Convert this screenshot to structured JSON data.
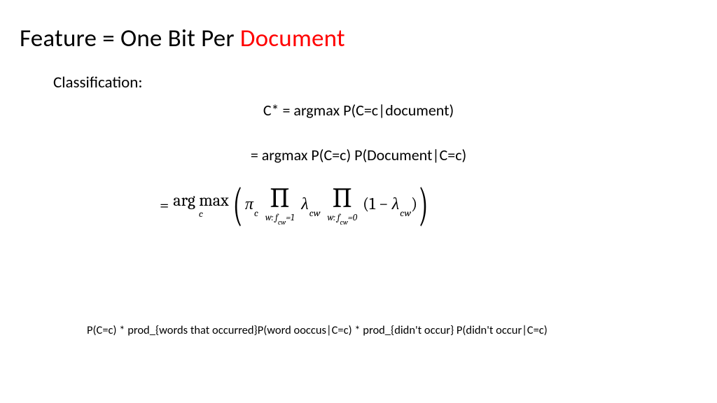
{
  "title_prefix": "Feature = One Bit Per ",
  "title_red": "Document",
  "subhead": "Classification:",
  "eq1": "C* = argmax P(C=c|document)",
  "eq2": "= argmax P(C=c) P(Document|C=c)",
  "math": {
    "eq": "=",
    "argmax_top": "arg max",
    "argmax_sub": "c",
    "lparen": "(",
    "rparen": ")",
    "pi": "π",
    "pi_sub": "c",
    "prod_sym": "∏",
    "prod1_sub_pre": "w: f",
    "prod1_sub_subsub": "cw",
    "prod1_sub_post": "=1",
    "lambda": "λ",
    "lambda_sub": "cw",
    "prod2_sub_pre": "w: f",
    "prod2_sub_subsub": "cw",
    "prod2_sub_post": "=0",
    "one_minus_open": "(1 − ",
    "one_minus_close": ")"
  },
  "footnote": "P(C=c) * prod_{words that occurred}P(word ooccus|C=c) * prod_{didn't occur} P(didn't occur|C=c)"
}
